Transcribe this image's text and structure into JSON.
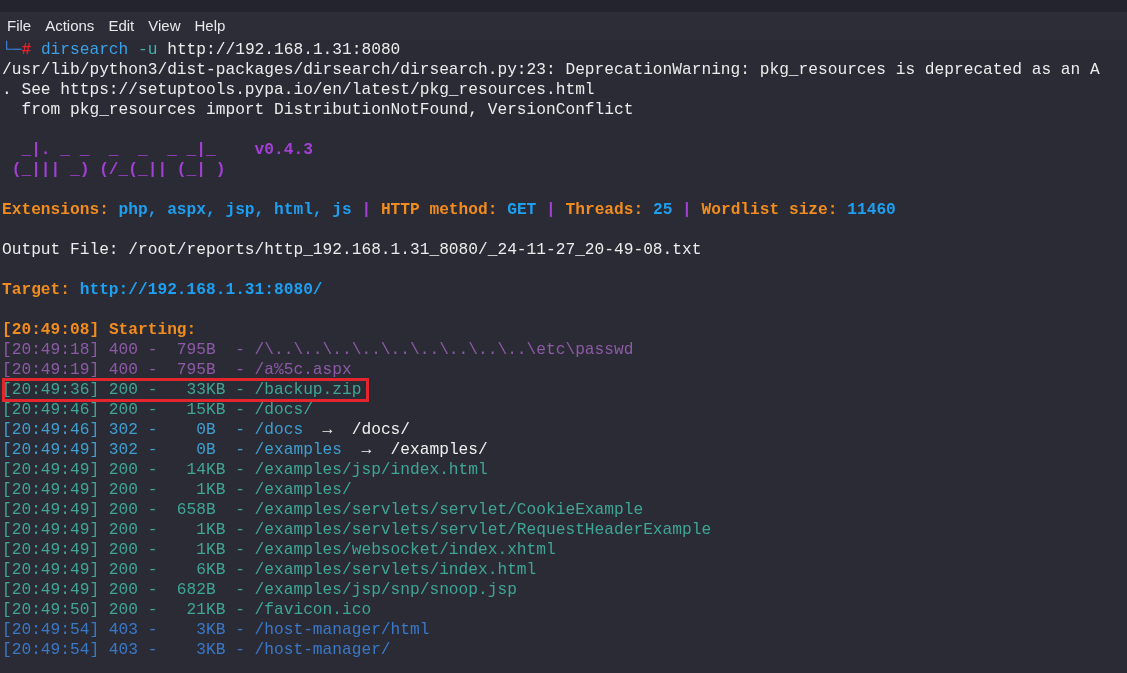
{
  "menu": [
    "File",
    "Actions",
    "Edit",
    "View",
    "Help"
  ],
  "prompt": {
    "corner": "└─",
    "symbol": "#",
    "command": "dirsearch",
    "option": "-u",
    "argument": "http://192.168.1.31:8080"
  },
  "warning_lines": [
    "/usr/lib/python3/dist-packages/dirsearch/dirsearch.py:23: DeprecationWarning: pkg_resources is deprecated as an A",
    ". See https://setuptools.pypa.io/en/latest/pkg_resources.html",
    "  from pkg_resources import DistributionNotFound, VersionConflict"
  ],
  "banner": {
    "art": [
      "  _|. _ _  _  _  _ _|_",
      "(_||| _) (/_(_|| (_| )"
    ],
    "version": "v0.4.3"
  },
  "config": [
    {
      "label": "Extensions:",
      "value": "php, aspx, jsp, html, js"
    },
    {
      "label": "HTTP method:",
      "value": "GET"
    },
    {
      "label": "Threads:",
      "value": "25"
    },
    {
      "label": "Wordlist size:",
      "value": "11460"
    }
  ],
  "separator": "|",
  "column_dash": "-",
  "output_file": "Output File: /root/reports/http_192.168.1.31_8080/_24-11-27_20-49-08.txt",
  "target": {
    "label": "Target:",
    "value": "http://192.168.1.31:8080/"
  },
  "start": {
    "time": "[20:49:08]",
    "text": "Starting:"
  },
  "results": [
    {
      "time": "[20:49:18]",
      "status": "400",
      "size": "795B",
      "path": "/\\..\\..\\..\\..\\..\\..\\..\\..\\..\\etc\\passwd",
      "color": "#8d5aa6",
      "highlighted": false
    },
    {
      "time": "[20:49:19]",
      "status": "400",
      "size": "795B",
      "path": "/a%5c.aspx",
      "color": "#8d5aa6",
      "highlighted": false
    },
    {
      "time": "[20:49:36]",
      "status": "200",
      "size": "33KB",
      "path": "/backup.zip",
      "color": "#3fa596",
      "highlighted": true
    },
    {
      "time": "[20:49:46]",
      "status": "200",
      "size": "15KB",
      "path": "/docs/",
      "color": "#3fa596",
      "highlighted": false
    },
    {
      "time": "[20:49:46]",
      "status": "302",
      "size": "0B",
      "path": "/docs",
      "arrow": "→",
      "redirect": "/docs/",
      "color": "#3f9fd0",
      "highlighted": false
    },
    {
      "time": "[20:49:49]",
      "status": "302",
      "size": "0B",
      "path": "/examples",
      "arrow": "→",
      "redirect": "/examples/",
      "color": "#3f9fd0",
      "highlighted": false
    },
    {
      "time": "[20:49:49]",
      "status": "200",
      "size": "14KB",
      "path": "/examples/jsp/index.html",
      "color": "#3fa596",
      "highlighted": false
    },
    {
      "time": "[20:49:49]",
      "status": "200",
      "size": "1KB",
      "path": "/examples/",
      "color": "#3fa596",
      "highlighted": false
    },
    {
      "time": "[20:49:49]",
      "status": "200",
      "size": "658B",
      "path": "/examples/servlets/servlet/CookieExample",
      "color": "#3fa596",
      "highlighted": false
    },
    {
      "time": "[20:49:49]",
      "status": "200",
      "size": "1KB",
      "path": "/examples/servlets/servlet/RequestHeaderExample",
      "color": "#3fa596",
      "highlighted": false
    },
    {
      "time": "[20:49:49]",
      "status": "200",
      "size": "1KB",
      "path": "/examples/websocket/index.xhtml",
      "color": "#3fa596",
      "highlighted": false
    },
    {
      "time": "[20:49:49]",
      "status": "200",
      "size": "6KB",
      "path": "/examples/servlets/index.html",
      "color": "#3fa596",
      "highlighted": false
    },
    {
      "time": "[20:49:49]",
      "status": "200",
      "size": "682B",
      "path": "/examples/jsp/snp/snoop.jsp",
      "color": "#3fa596",
      "highlighted": false
    },
    {
      "time": "[20:49:50]",
      "status": "200",
      "size": "21KB",
      "path": "/favicon.ico",
      "color": "#3fa596",
      "highlighted": false
    },
    {
      "time": "[20:49:54]",
      "status": "403",
      "size": "3KB",
      "path": "/host-manager/html",
      "color": "#3a78c8",
      "highlighted": false
    },
    {
      "time": "[20:49:54]",
      "status": "403",
      "size": "3KB",
      "path": "/host-manager/",
      "color": "#3a78c8",
      "highlighted": false
    }
  ]
}
